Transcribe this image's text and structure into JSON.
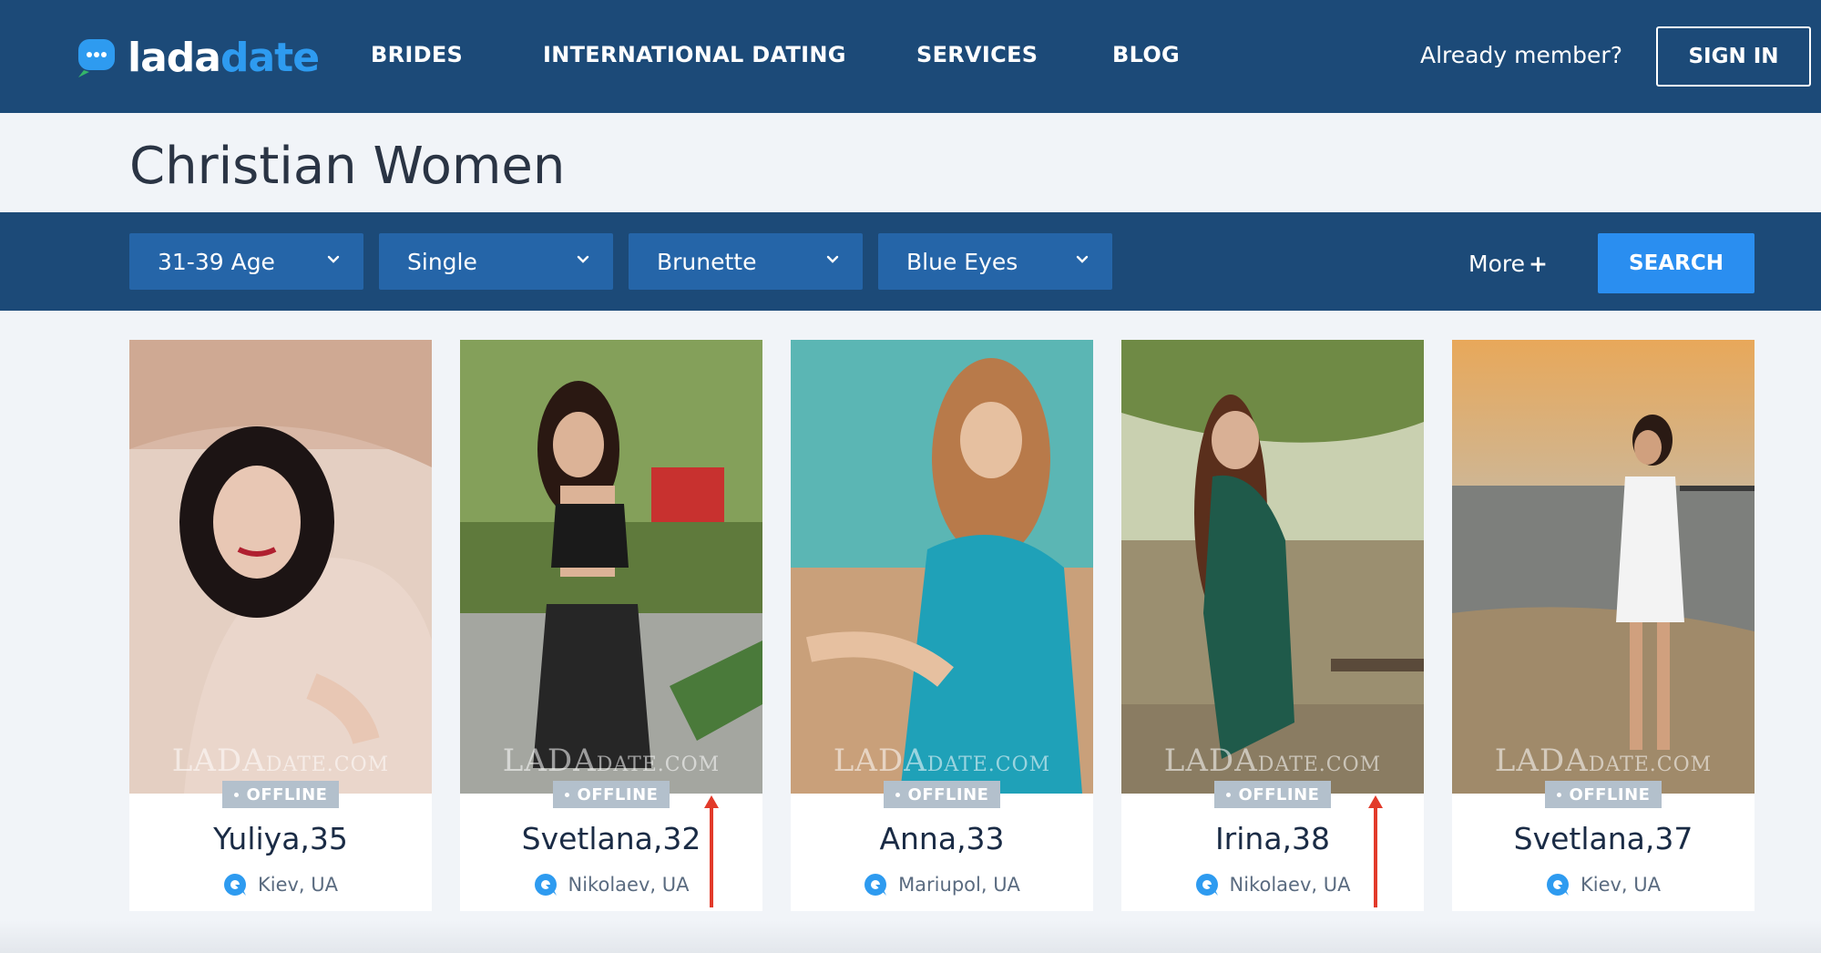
{
  "header": {
    "logo": {
      "part1": "lada",
      "part2": "date"
    },
    "nav": [
      "BRIDES",
      "INTERNATIONAL DATING",
      "SERVICES",
      "BLOG"
    ],
    "member_text": "Already member?",
    "signin_label": "SIGN IN"
  },
  "page": {
    "title": "Christian Women"
  },
  "filters": {
    "selects": [
      "31-39 Age",
      "Single",
      "Brunette",
      "Blue Eyes"
    ],
    "more_label": "More",
    "more_symbol": "+",
    "search_label": "SEARCH"
  },
  "profiles": [
    {
      "name": "Yuliya,35",
      "location": "Kiev, UA",
      "status": "OFFLINE"
    },
    {
      "name": "Svetlana,32",
      "location": "Nikolaev, UA",
      "status": "OFFLINE"
    },
    {
      "name": "Anna,33",
      "location": "Mariupol, UA",
      "status": "OFFLINE"
    },
    {
      "name": "Irina,38",
      "location": "Nikolaev, UA",
      "status": "OFFLINE"
    },
    {
      "name": "Svetlana,37",
      "location": "Kiev, UA",
      "status": "OFFLINE"
    }
  ],
  "watermark": {
    "big": "LADA",
    "small": "DATE.COM"
  },
  "colors": {
    "header_bg": "#1c4a78",
    "select_bg": "#2565a8",
    "accent": "#2a8ef0",
    "status_badge": "#b3c0cc",
    "arrow": "#e23a2a"
  },
  "icons": {
    "logo": "chat-bubble-icon",
    "dropdown": "chevron-down-icon",
    "location": "location-pin-icon"
  }
}
